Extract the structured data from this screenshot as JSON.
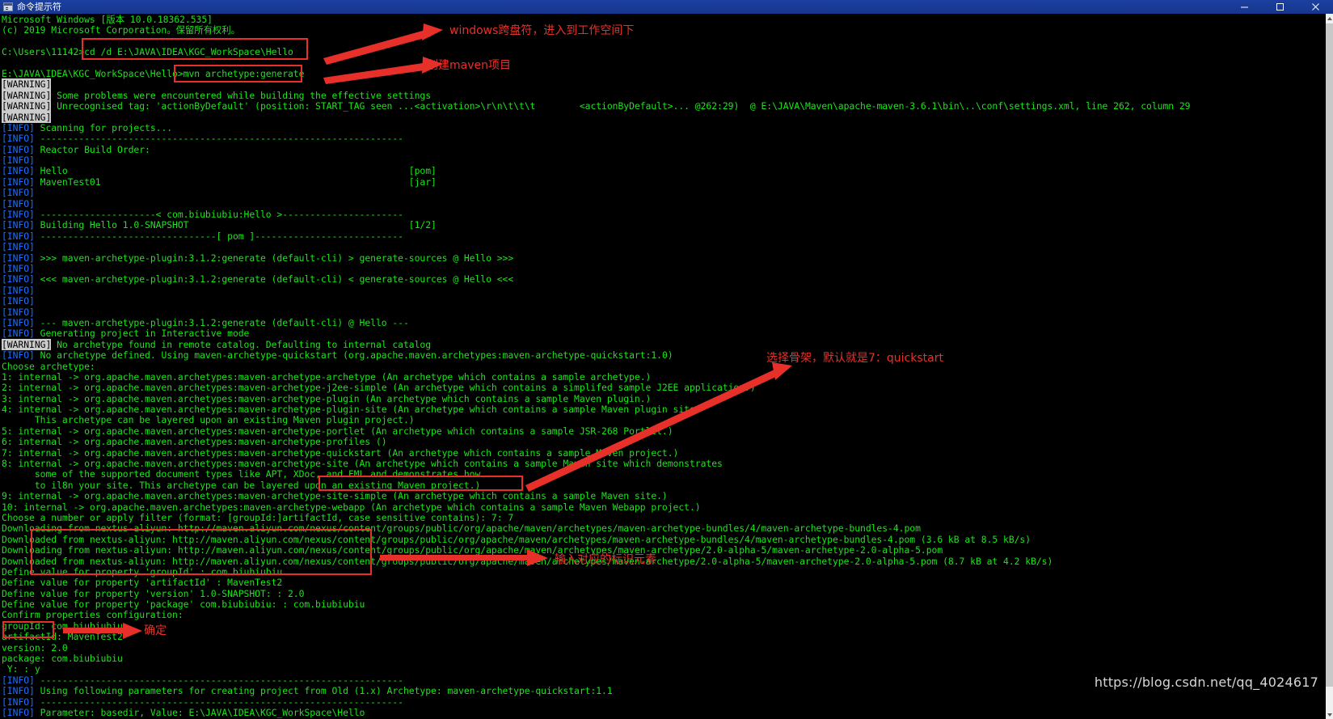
{
  "window": {
    "title": "命令提示符",
    "icon": "console-icon",
    "controls": {
      "minimize": "minimize-icon",
      "maximize": "maximize-icon",
      "close": "close-icon"
    }
  },
  "watermark": "https://blog.csdn.net/qq_4024617",
  "annotations": [
    {
      "id": "note-cd-command",
      "text": "windows跨盘符，进入到工作空间下"
    },
    {
      "id": "note-create-maven",
      "text": "创建maven项目"
    },
    {
      "id": "note-choose-archetype",
      "text": "选择骨架，默认就是7：quickstart"
    },
    {
      "id": "note-enter-properties",
      "text": "输入对应的标识元素"
    },
    {
      "id": "note-confirm",
      "text": "确定"
    }
  ],
  "terminal": {
    "lines": [
      {
        "id": 0,
        "segs": [
          {
            "c": "g",
            "t": "Microsoft Windows [版本 10.0.18362.535]"
          }
        ]
      },
      {
        "id": 1,
        "segs": [
          {
            "c": "g",
            "t": "(c) 2019 Microsoft Corporation。保留所有权利。"
          }
        ]
      },
      {
        "id": 2,
        "segs": [
          {
            "c": "g",
            "t": ""
          }
        ]
      },
      {
        "id": 3,
        "segs": [
          {
            "c": "g",
            "t": "C:\\Users\\11142>cd /d E:\\JAVA\\IDEA\\KGC_WorkSpace\\Hello"
          }
        ]
      },
      {
        "id": 4,
        "segs": [
          {
            "c": "g",
            "t": ""
          }
        ]
      },
      {
        "id": 5,
        "segs": [
          {
            "c": "g",
            "t": "E:\\JAVA\\IDEA\\KGC_WorkSpace\\Hello>mvn archetype:generate"
          }
        ]
      },
      {
        "id": 6,
        "segs": [
          {
            "c": "wh",
            "t": "[WARNING]"
          }
        ]
      },
      {
        "id": 7,
        "segs": [
          {
            "c": "wh",
            "t": "[WARNING]"
          },
          {
            "c": "g",
            "t": " Some problems were encountered while building the effective settings"
          }
        ]
      },
      {
        "id": 8,
        "segs": [
          {
            "c": "wh",
            "t": "[WARNING]"
          },
          {
            "c": "g",
            "t": " Unrecognised tag: 'actionByDefault' (position: START_TAG seen ...<activation>\\r\\n\\t\\t\\t        <actionByDefault>... @262:29)  @ E:\\JAVA\\Maven\\apache-maven-3.6.1\\bin\\..\\conf\\settings.xml, line 262, column 29"
          }
        ]
      },
      {
        "id": 9,
        "segs": [
          {
            "c": "wh",
            "t": "[WARNING]"
          }
        ]
      },
      {
        "id": 10,
        "segs": [
          {
            "c": "i",
            "t": "[INFO]"
          },
          {
            "c": "g",
            "t": " Scanning for projects..."
          }
        ]
      },
      {
        "id": 11,
        "segs": [
          {
            "c": "i",
            "t": "[INFO]"
          },
          {
            "c": "g",
            "t": " ------------------------------------------------------------------"
          }
        ]
      },
      {
        "id": 12,
        "segs": [
          {
            "c": "i",
            "t": "[INFO]"
          },
          {
            "c": "g",
            "t": " Reactor Build Order:"
          }
        ]
      },
      {
        "id": 13,
        "segs": [
          {
            "c": "i",
            "t": "[INFO]"
          }
        ]
      },
      {
        "id": 14,
        "segs": [
          {
            "c": "i",
            "t": "[INFO]"
          },
          {
            "c": "g",
            "t": " Hello                                                              [pom]"
          }
        ]
      },
      {
        "id": 15,
        "segs": [
          {
            "c": "i",
            "t": "[INFO]"
          },
          {
            "c": "g",
            "t": " MavenTest01                                                        [jar]"
          }
        ]
      },
      {
        "id": 16,
        "segs": [
          {
            "c": "i",
            "t": "[INFO]"
          }
        ]
      },
      {
        "id": 17,
        "segs": [
          {
            "c": "i",
            "t": "[INFO]"
          }
        ]
      },
      {
        "id": 18,
        "segs": [
          {
            "c": "i",
            "t": "[INFO]"
          },
          {
            "c": "g",
            "t": " ---------------------< com.biubiubiu:Hello >----------------------"
          }
        ]
      },
      {
        "id": 19,
        "segs": [
          {
            "c": "i",
            "t": "[INFO]"
          },
          {
            "c": "g",
            "t": " Building Hello 1.0-SNAPSHOT                                        [1/2]"
          }
        ]
      },
      {
        "id": 20,
        "segs": [
          {
            "c": "i",
            "t": "[INFO]"
          },
          {
            "c": "g",
            "t": " --------------------------------[ pom ]---------------------------"
          }
        ]
      },
      {
        "id": 21,
        "segs": [
          {
            "c": "i",
            "t": "[INFO]"
          }
        ]
      },
      {
        "id": 22,
        "segs": [
          {
            "c": "i",
            "t": "[INFO]"
          },
          {
            "c": "g",
            "t": " >>> maven-archetype-plugin:3.1.2:generate (default-cli) > generate-sources @ Hello >>>"
          }
        ]
      },
      {
        "id": 23,
        "segs": [
          {
            "c": "i",
            "t": "[INFO]"
          }
        ]
      },
      {
        "id": 24,
        "segs": [
          {
            "c": "i",
            "t": "[INFO]"
          },
          {
            "c": "g",
            "t": " <<< maven-archetype-plugin:3.1.2:generate (default-cli) < generate-sources @ Hello <<<"
          }
        ]
      },
      {
        "id": 25,
        "segs": [
          {
            "c": "i",
            "t": "[INFO]"
          }
        ]
      },
      {
        "id": 26,
        "segs": [
          {
            "c": "i",
            "t": "[INFO]"
          }
        ]
      },
      {
        "id": 27,
        "segs": [
          {
            "c": "i",
            "t": "[INFO]"
          }
        ]
      },
      {
        "id": 28,
        "segs": [
          {
            "c": "i",
            "t": "[INFO]"
          },
          {
            "c": "g",
            "t": " --- maven-archetype-plugin:3.1.2:generate (default-cli) @ Hello ---"
          }
        ]
      },
      {
        "id": 29,
        "segs": [
          {
            "c": "i",
            "t": "[INFO]"
          },
          {
            "c": "g",
            "t": " Generating project in Interactive mode"
          }
        ]
      },
      {
        "id": 30,
        "segs": [
          {
            "c": "wh",
            "t": "[WARNING]"
          },
          {
            "c": "g",
            "t": " No archetype found in remote catalog. Defaulting to internal catalog"
          }
        ]
      },
      {
        "id": 31,
        "segs": [
          {
            "c": "i",
            "t": "[INFO]"
          },
          {
            "c": "g",
            "t": " No archetype defined. Using maven-archetype-quickstart (org.apache.maven.archetypes:maven-archetype-quickstart:1.0)"
          }
        ]
      },
      {
        "id": 32,
        "segs": [
          {
            "c": "g",
            "t": "Choose archetype:"
          }
        ]
      },
      {
        "id": 33,
        "segs": [
          {
            "c": "g",
            "t": "1: internal -> org.apache.maven.archetypes:maven-archetype-archetype (An archetype which contains a sample archetype.)"
          }
        ]
      },
      {
        "id": 34,
        "segs": [
          {
            "c": "g",
            "t": "2: internal -> org.apache.maven.archetypes:maven-archetype-j2ee-simple (An archetype which contains a simplifed sample J2EE application.)"
          }
        ]
      },
      {
        "id": 35,
        "segs": [
          {
            "c": "g",
            "t": "3: internal -> org.apache.maven.archetypes:maven-archetype-plugin (An archetype which contains a sample Maven plugin.)"
          }
        ]
      },
      {
        "id": 36,
        "segs": [
          {
            "c": "g",
            "t": "4: internal -> org.apache.maven.archetypes:maven-archetype-plugin-site (An archetype which contains a sample Maven plugin site."
          }
        ]
      },
      {
        "id": 37,
        "segs": [
          {
            "c": "g",
            "t": "      This archetype can be layered upon an existing Maven plugin project.)"
          }
        ]
      },
      {
        "id": 38,
        "segs": [
          {
            "c": "g",
            "t": "5: internal -> org.apache.maven.archetypes:maven-archetype-portlet (An archetype which contains a sample JSR-268 Portlet.)"
          }
        ]
      },
      {
        "id": 39,
        "segs": [
          {
            "c": "g",
            "t": "6: internal -> org.apache.maven.archetypes:maven-archetype-profiles ()"
          }
        ]
      },
      {
        "id": 40,
        "segs": [
          {
            "c": "g",
            "t": "7: internal -> org.apache.maven.archetypes:maven-archetype-quickstart (An archetype which contains a sample Maven project.)"
          }
        ]
      },
      {
        "id": 41,
        "segs": [
          {
            "c": "g",
            "t": "8: internal -> org.apache.maven.archetypes:maven-archetype-site (An archetype which contains a sample Maven site which demonstrates"
          }
        ]
      },
      {
        "id": 42,
        "segs": [
          {
            "c": "g",
            "t": "      some of the supported document types like APT, XDoc, and FML and demonstrates how"
          }
        ]
      },
      {
        "id": 43,
        "segs": [
          {
            "c": "g",
            "t": "      to il8n your site. This archetype can be layered upon an existing Maven project.)"
          }
        ]
      },
      {
        "id": 44,
        "segs": [
          {
            "c": "g",
            "t": "9: internal -> org.apache.maven.archetypes:maven-archetype-site-simple (An archetype which contains a sample Maven site.)"
          }
        ]
      },
      {
        "id": 45,
        "segs": [
          {
            "c": "g",
            "t": "10: internal -> org.apache.maven.archetypes:maven-archetype-webapp (An archetype which contains a sample Maven Webapp project.)"
          }
        ]
      },
      {
        "id": 46,
        "segs": [
          {
            "c": "g",
            "t": "Choose a number or apply filter (format: [groupId:]artifactId, case sensitive contains): 7: 7"
          }
        ]
      },
      {
        "id": 47,
        "segs": [
          {
            "c": "g",
            "t": "Downloading from nextus-aliyun: http://maven.aliyun.com/nexus/content/groups/public/org/apache/maven/archetypes/maven-archetype-bundles/4/maven-archetype-bundles-4.pom"
          }
        ]
      },
      {
        "id": 48,
        "segs": [
          {
            "c": "g",
            "t": "Downloaded from nextus-aliyun: http://maven.aliyun.com/nexus/content/groups/public/org/apache/maven/archetypes/maven-archetype-bundles/4/maven-archetype-bundles-4.pom (3.6 kB at 8.5 kB/s)"
          }
        ]
      },
      {
        "id": 49,
        "segs": [
          {
            "c": "g",
            "t": "Downloading from nextus-aliyun: http://maven.aliyun.com/nexus/content/groups/public/org/apache/maven/archetypes/maven-archetype/2.0-alpha-5/maven-archetype-2.0-alpha-5.pom"
          }
        ]
      },
      {
        "id": 50,
        "segs": [
          {
            "c": "g",
            "t": "Downloaded from nextus-aliyun: http://maven.aliyun.com/nexus/content/groups/public/org/apache/maven/archetypes/maven-archetype/2.0-alpha-5/maven-archetype-2.0-alpha-5.pom (8.7 kB at 4.2 kB/s)"
          }
        ]
      },
      {
        "id": 51,
        "segs": [
          {
            "c": "g",
            "t": "Define value for property 'groupId' : com.biubiubiu"
          }
        ]
      },
      {
        "id": 52,
        "segs": [
          {
            "c": "g",
            "t": "Define value for property 'artifactId' : MavenTest2"
          }
        ]
      },
      {
        "id": 53,
        "segs": [
          {
            "c": "g",
            "t": "Define value for property 'version' 1.0-SNAPSHOT: : 2.0"
          }
        ]
      },
      {
        "id": 54,
        "segs": [
          {
            "c": "g",
            "t": "Define value for property 'package' com.biubiubiu: : com.biubiubiu"
          }
        ]
      },
      {
        "id": 55,
        "segs": [
          {
            "c": "g",
            "t": "Confirm properties configuration:"
          }
        ]
      },
      {
        "id": 56,
        "segs": [
          {
            "c": "g",
            "t": "groupId: com.biubiubiu"
          }
        ]
      },
      {
        "id": 57,
        "segs": [
          {
            "c": "g",
            "t": "artifactId: MavenTest2"
          }
        ]
      },
      {
        "id": 58,
        "segs": [
          {
            "c": "g",
            "t": "version: 2.0"
          }
        ]
      },
      {
        "id": 59,
        "segs": [
          {
            "c": "g",
            "t": "package: com.biubiubiu"
          }
        ]
      },
      {
        "id": 60,
        "segs": [
          {
            "c": "g",
            "t": " Y: : y"
          }
        ]
      },
      {
        "id": 61,
        "segs": [
          {
            "c": "i",
            "t": "[INFO]"
          },
          {
            "c": "g",
            "t": " ------------------------------------------------------------------"
          }
        ]
      },
      {
        "id": 62,
        "segs": [
          {
            "c": "i",
            "t": "[INFO]"
          },
          {
            "c": "g",
            "t": " Using following parameters for creating project from Old (1.x) Archetype: maven-archetype-quickstart:1.1"
          }
        ]
      },
      {
        "id": 63,
        "segs": [
          {
            "c": "i",
            "t": "[INFO]"
          },
          {
            "c": "g",
            "t": " ------------------------------------------------------------------"
          }
        ]
      },
      {
        "id": 64,
        "segs": [
          {
            "c": "i",
            "t": "[INFO]"
          },
          {
            "c": "g",
            "t": " Parameter: basedir, Value: E:\\JAVA\\IDEA\\KGC_WorkSpace\\Hello"
          }
        ]
      }
    ]
  }
}
